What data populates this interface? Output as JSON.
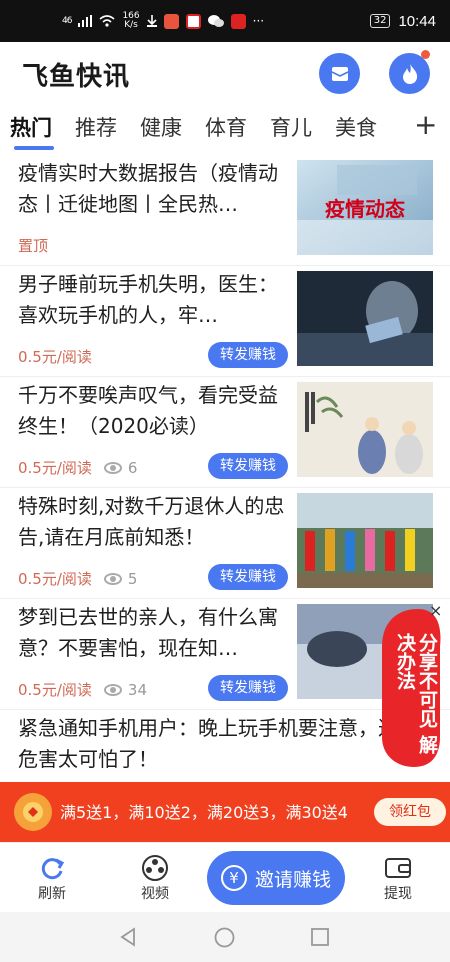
{
  "status_bar": {
    "network": "46",
    "speed_value": "166",
    "speed_unit": "K/s",
    "more": "···",
    "battery": "32",
    "time": "10:44"
  },
  "header": {
    "title": "飞鱼快讯",
    "message_icon": "envelope-icon",
    "hot_icon": "fire-icon"
  },
  "tabs": [
    {
      "label": "热门",
      "active": true
    },
    {
      "label": "推荐"
    },
    {
      "label": "健康"
    },
    {
      "label": "体育"
    },
    {
      "label": "育儿"
    },
    {
      "label": "美食"
    }
  ],
  "tabs_more": "+",
  "feed": [
    {
      "title": "疫情实时大数据报告（疫情动态丨迁徙地图丨全民热…",
      "tag": "置顶",
      "image_caption": "疫情动态"
    },
    {
      "title": "男子睡前玩手机失明，医生：喜欢玩手机的人，牢…",
      "price": "0.5元/阅读",
      "share": "转发赚钱"
    },
    {
      "title": "千万不要唉声叹气，看完受益终生！（2020必读）",
      "price": "0.5元/阅读",
      "views": "6",
      "share": "转发赚钱"
    },
    {
      "title": "特殊时刻,对数千万退休人的忠告,请在月底前知悉！",
      "price": "0.5元/阅读",
      "views": "5",
      "share": "转发赚钱"
    },
    {
      "title": "梦到已去世的亲人，有什么寓意？不要害怕，现在知…",
      "price": "0.5元/阅读",
      "views": "34",
      "share": "转发赚钱"
    },
    {
      "title": "紧急通知手机用户：晚上玩手机要注意，这些危害太可怕了！"
    }
  ],
  "float_promo": {
    "text": "分享不可见 解决办法",
    "close": "×"
  },
  "red_banner": {
    "text": "满5送1，满10送2，满20送3，满30送4",
    "button": "领红包"
  },
  "bottom_nav": {
    "refresh": "刷新",
    "video": "视频",
    "invite": "邀请赚钱",
    "invite_symbol": "¥",
    "withdraw": "提现"
  },
  "colors": {
    "accent": "#4a78f0",
    "price": "#d06a55",
    "banner": "#f0401f"
  }
}
